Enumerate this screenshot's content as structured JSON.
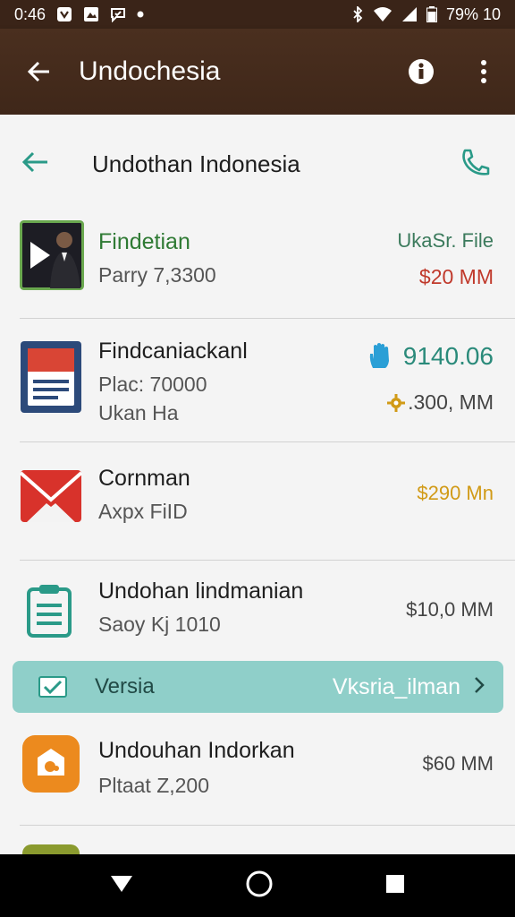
{
  "status_bar": {
    "time": "0:46",
    "battery": "79% 10"
  },
  "app_bar": {
    "title": "Undochesia"
  },
  "sub_header": {
    "title": "Undothan Indonesia"
  },
  "rows": [
    {
      "title": "Findetian",
      "sub": "Parry 7,3300",
      "right_top": "UkaSr. File",
      "right_bottom": "$20 MM"
    },
    {
      "title": "Findcaniackanl",
      "sub": "Plac: 70000",
      "sub2": "Ukan Ha",
      "right_top": "9140.06",
      "right_bottom": ".300, MM"
    },
    {
      "title": "Cornman",
      "sub": "Axpx FiID",
      "right_top": "$290 Mn"
    },
    {
      "title": "Undohan lindmanian",
      "sub": "Saoy Kj 1010",
      "right_top": "$10,0 MM"
    },
    {
      "title": "Undouhan Indorkan",
      "sub": "Pltaat Z,200",
      "right_top": "$60 MM"
    }
  ],
  "banner": {
    "label": "Versia",
    "value": "Vksria_ilman"
  },
  "colors": {
    "app_bar": "#3f2719",
    "accent_green": "#2f8a3a",
    "teal": "#2a9a88",
    "banner": "#8fcfc9",
    "price_red": "#c0392b",
    "price_gold": "#d19a16"
  }
}
